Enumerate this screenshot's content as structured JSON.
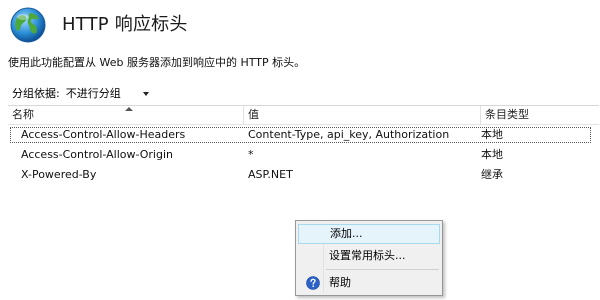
{
  "header": {
    "title": "HTTP 响应标头",
    "description": "使用此功能配置从 Web 服务器添加到响应中的 HTTP 标头。"
  },
  "group_by": {
    "label": "分组依据:",
    "selected": "不进行分组"
  },
  "table": {
    "columns": [
      "名称",
      "值",
      "条目类型"
    ],
    "rows": [
      {
        "name": "Access-Control-Allow-Headers",
        "value": "Content-Type, api_key, Authorization",
        "type": "本地"
      },
      {
        "name": "Access-Control-Allow-Origin",
        "value": "*",
        "type": "本地"
      },
      {
        "name": "X-Powered-By",
        "value": "ASP.NET",
        "type": "继承"
      }
    ]
  },
  "context_menu": {
    "items": [
      {
        "label": "添加..."
      },
      {
        "label": "设置常用标头..."
      },
      {
        "label": "帮助",
        "icon": "help-icon"
      }
    ]
  },
  "colors": {
    "menu_highlight": "#e5f3fb",
    "menu_highlight_border": "#a8d8f0",
    "help_icon": "#2a62c9"
  }
}
